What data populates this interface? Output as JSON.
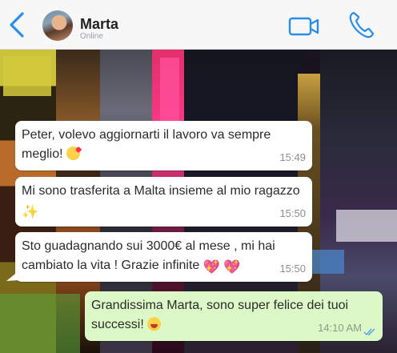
{
  "header": {
    "back_icon": "chevron-left-icon",
    "contact_name": "Marta",
    "status": "Online",
    "video_icon": "video-camera-icon",
    "call_icon": "phone-icon",
    "accent_color": "#2a8ee8"
  },
  "messages": [
    {
      "direction": "incoming",
      "text": "Peter, volevo aggiornarti il lavoro va sempre meglio!",
      "emoji": "face-blowing-kiss",
      "time": "15:49"
    },
    {
      "direction": "incoming",
      "text": "Mi sono trasferita a Malta insieme al mio ragazzo",
      "emoji": "sparkle",
      "time": "15:50"
    },
    {
      "direction": "incoming",
      "text": "Sto guadagnando sui 3000€ al mese , mi hai cambiato la vita ! Grazie infinite",
      "emoji": "sparkling-heart",
      "time": "15:50"
    },
    {
      "direction": "outgoing",
      "text": "Grandissima Marta, sono super felice dei tuoi successi!",
      "emoji": "grinning-face",
      "time": "14:10 AM",
      "read": true
    }
  ],
  "colors": {
    "outgoing_bubble": "#dcf8c6",
    "incoming_bubble": "#ffffff",
    "read_ticks": "#4fa3e0"
  }
}
